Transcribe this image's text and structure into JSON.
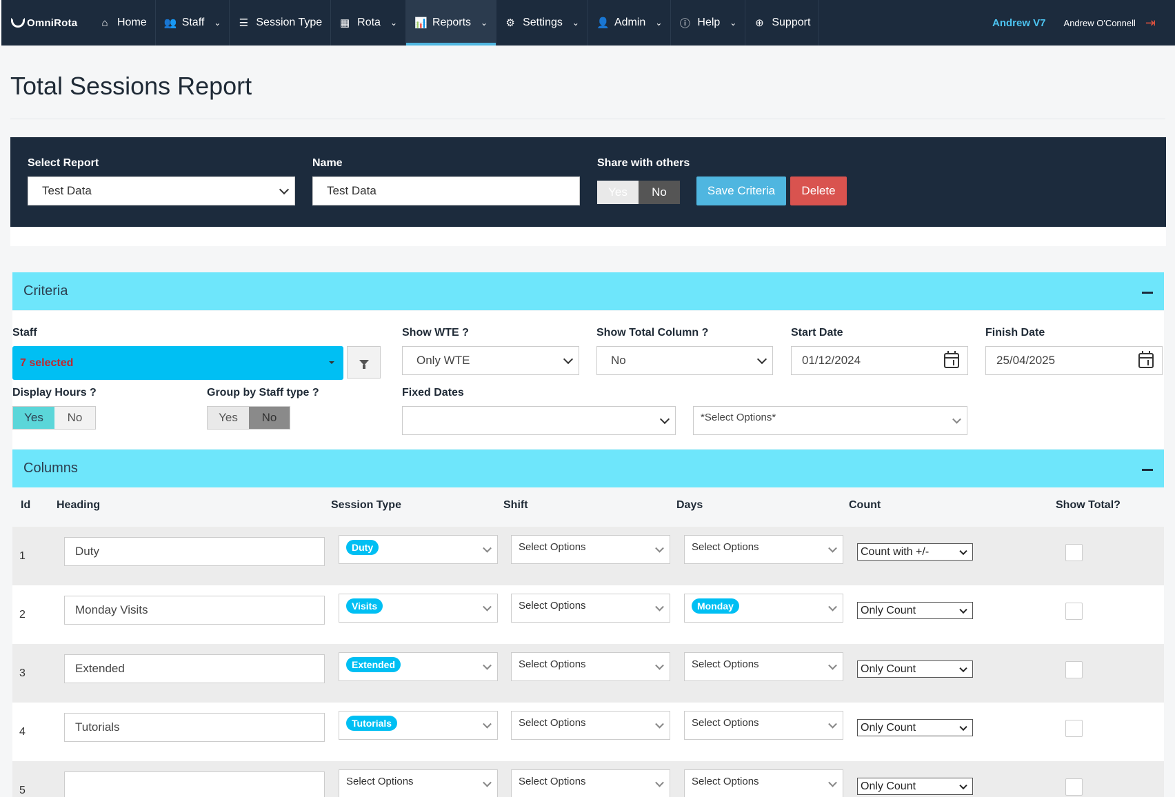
{
  "nav": {
    "brand": "OmniRota",
    "items": [
      {
        "label": "Home",
        "icon": "home-icon",
        "glyph": "⌂",
        "caret": false
      },
      {
        "label": "Staff",
        "icon": "users-icon",
        "glyph": "👥",
        "caret": true
      },
      {
        "label": "Session Type",
        "icon": "list-icon",
        "glyph": "☰",
        "caret": false
      },
      {
        "label": "Rota",
        "icon": "calendar-icon",
        "glyph": "▦",
        "caret": true
      },
      {
        "label": "Reports",
        "icon": "bar-chart-icon",
        "glyph": "📊",
        "caret": true,
        "active": true
      },
      {
        "label": "Settings",
        "icon": "gear-icon",
        "glyph": "⚙",
        "caret": true
      },
      {
        "label": "Admin",
        "icon": "user-icon",
        "glyph": "👤",
        "caret": true
      },
      {
        "label": "Help",
        "icon": "info-icon",
        "glyph": "ⓘ",
        "caret": true
      },
      {
        "label": "Support",
        "icon": "lifebuoy-icon",
        "glyph": "⊕",
        "caret": false
      }
    ],
    "company": "Andrew V7",
    "user": "Andrew O'Connell",
    "logout_icon": "logout-icon"
  },
  "page": {
    "title": "Total Sessions Report"
  },
  "report_header": {
    "select_report_label": "Select Report",
    "select_report_value": "Test Data",
    "name_label": "Name",
    "name_value": "Test Data",
    "share_label": "Share with others",
    "share_yes": "Yes",
    "share_no": "No",
    "share_selected": "No",
    "save_label": "Save Criteria",
    "delete_label": "Delete"
  },
  "criteria": {
    "title": "Criteria",
    "staff_label": "Staff",
    "staff_value": "7 selected",
    "show_wte_label": "Show WTE ?",
    "show_wte_value": "Only WTE",
    "show_total_label": "Show Total Column ?",
    "show_total_value": "No",
    "start_date_label": "Start Date",
    "start_date_value": "01/12/2024",
    "finish_date_label": "Finish Date",
    "finish_date_value": "25/04/2025",
    "display_hours_label": "Display Hours ?",
    "display_hours_yes": "Yes",
    "display_hours_no": "No",
    "display_hours_selected": "Yes",
    "group_label": "Group by Staff type ?",
    "group_yes": "Yes",
    "group_no": "No",
    "group_selected": "No",
    "fixed_dates_label": "Fixed Dates",
    "fixed_dates_value": "",
    "fixed_dates_options_placeholder": "*Select Options*"
  },
  "columns": {
    "title": "Columns",
    "headers": {
      "id": "Id",
      "heading": "Heading",
      "session_type": "Session Type",
      "shift": "Shift",
      "days": "Days",
      "count": "Count",
      "show_total": "Show Total?"
    },
    "placeholder": "Select Options",
    "rows": [
      {
        "id": "1",
        "heading": "Duty",
        "session_type": "Duty",
        "shift": "",
        "days": "",
        "count": "Count with +/-"
      },
      {
        "id": "2",
        "heading": "Monday Visits",
        "session_type": "Visits",
        "shift": "",
        "days": "Monday",
        "count": "Only Count"
      },
      {
        "id": "3",
        "heading": "Extended",
        "session_type": "Extended",
        "shift": "",
        "days": "",
        "count": "Only Count"
      },
      {
        "id": "4",
        "heading": "Tutorials",
        "session_type": "Tutorials",
        "shift": "",
        "days": "",
        "count": "Only Count"
      },
      {
        "id": "5",
        "heading": "",
        "session_type": "",
        "shift": "",
        "days": "",
        "count": "Only Count"
      }
    ]
  },
  "colors": {
    "nav_bg": "#1c2b3d",
    "accent_cyan": "#00bff3",
    "section_header": "#6ee6fb",
    "save_button": "#4fb6e0",
    "delete_button": "#d9534f",
    "toggle_active_teal": "#5bc0de"
  }
}
